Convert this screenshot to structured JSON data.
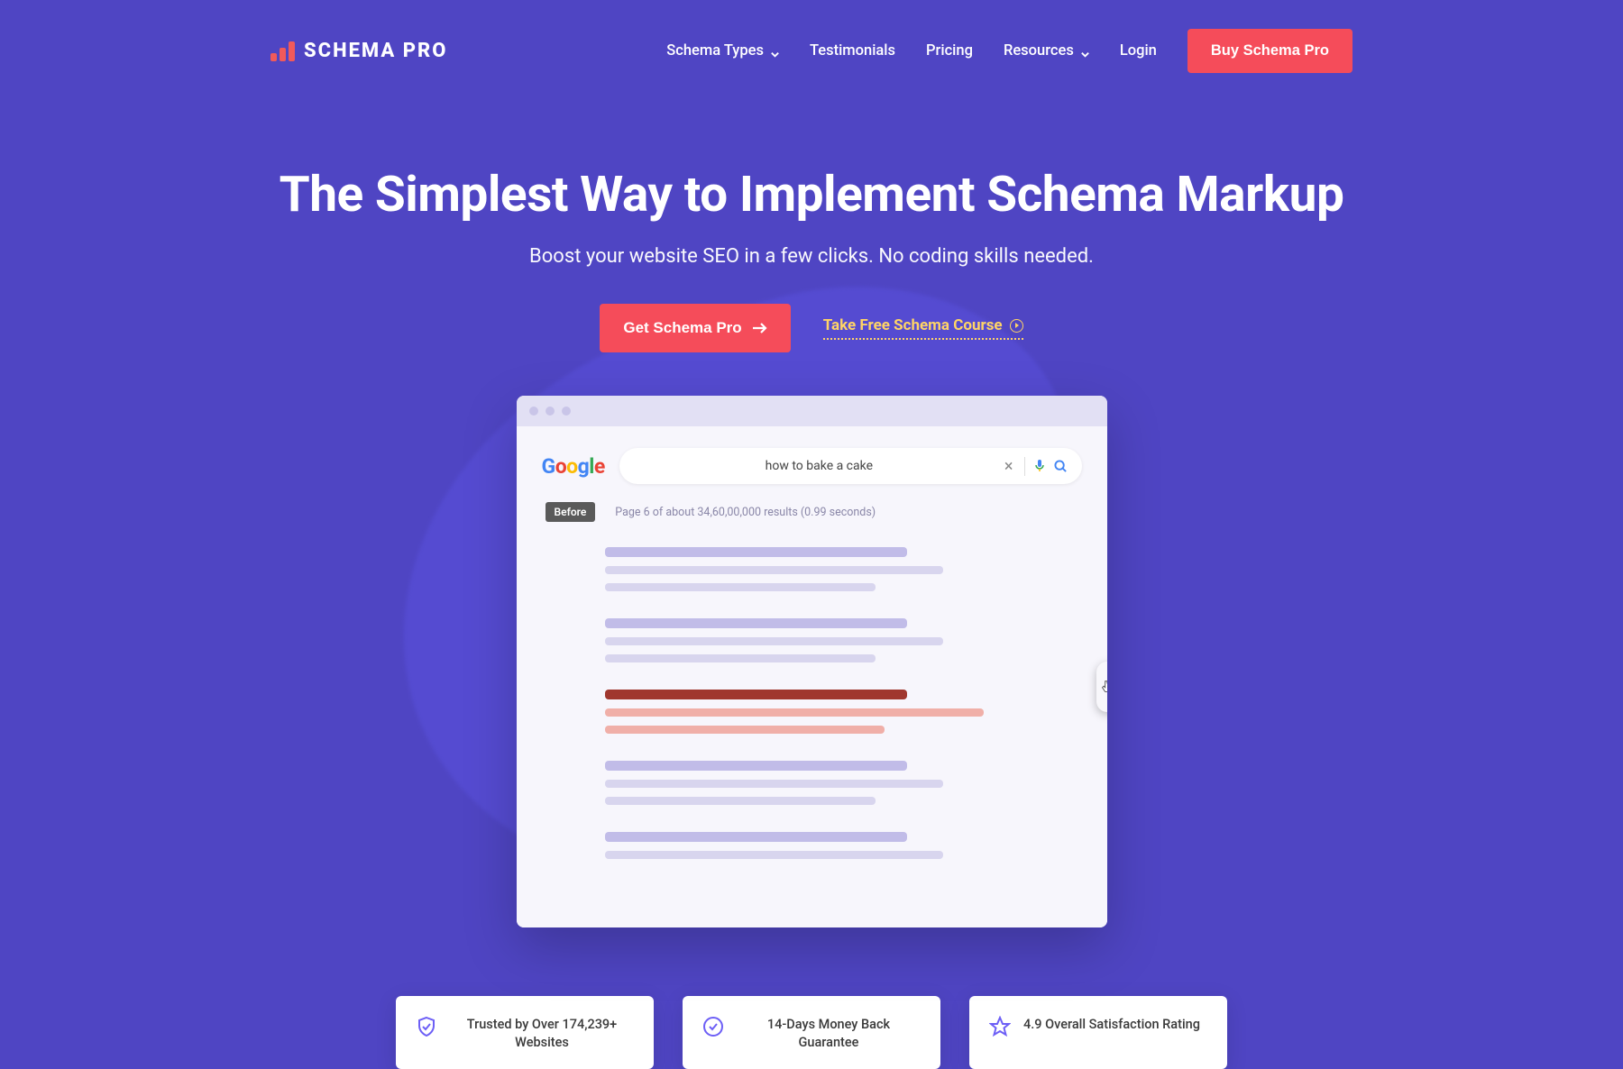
{
  "brand": {
    "name": "SCHEMA PRO"
  },
  "nav": {
    "items": [
      {
        "label": "Schema Types",
        "has_dropdown": true
      },
      {
        "label": "Testimonials",
        "has_dropdown": false
      },
      {
        "label": "Pricing",
        "has_dropdown": false
      },
      {
        "label": "Resources",
        "has_dropdown": true
      },
      {
        "label": "Login",
        "has_dropdown": false
      }
    ],
    "cta": "Buy Schema Pro"
  },
  "hero": {
    "headline": "The Simplest Way to Implement Schema Markup",
    "subheadline": "Boost your website SEO in a few clicks. No coding skills needed.",
    "primary_cta": "Get Schema Pro",
    "secondary_link": "Take Free Schema Course"
  },
  "browser_mock": {
    "search_query": "how to bake a cake",
    "before_label": "Before",
    "results_meta": "Page 6 of about 34,60,00,000 results (0.99 seconds)"
  },
  "trust": [
    {
      "text": "Trusted by Over 174,239+ Websites",
      "icon": "shield"
    },
    {
      "text": "14-Days Money Back Guarantee",
      "icon": "check"
    },
    {
      "text": "4.9 Overall Satisfaction Rating",
      "icon": "star"
    }
  ]
}
